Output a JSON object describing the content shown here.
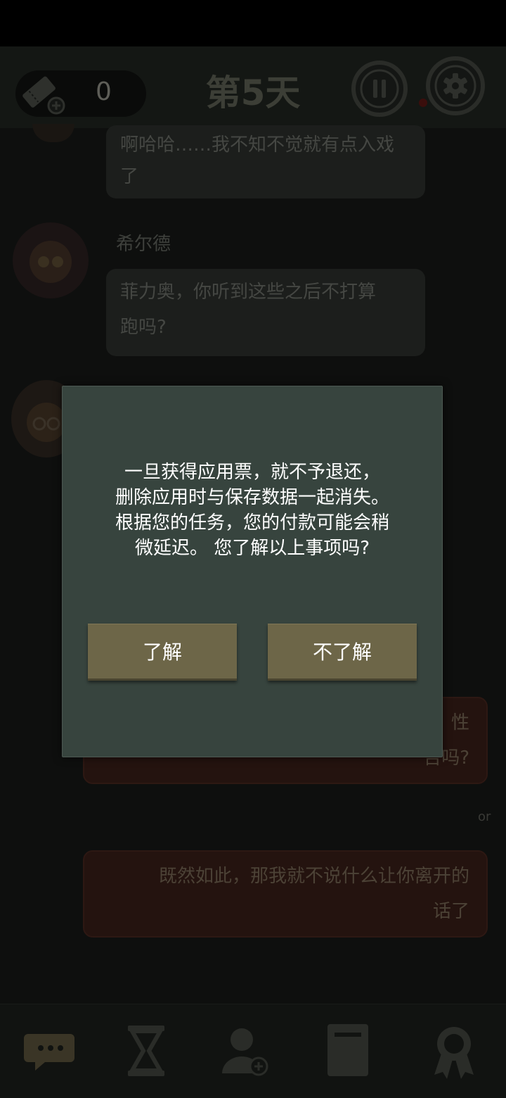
{
  "header": {
    "ticket_count": "0",
    "day_title": "第5天"
  },
  "chat": {
    "messages": [
      {
        "text_line1": "啊哈哈……我不知不觉就有点入戏",
        "text_line2": "了"
      },
      {
        "speaker": "希尔德",
        "text_line1": "菲力奥，你听到这些之后不打算",
        "text_line2": "跑吗?"
      }
    ],
    "reply_option_1": {
      "line1_fragment": "性",
      "line2_fragment": "告吗?"
    },
    "or_label": "or",
    "reply_option_2": {
      "text_line1": "既然如此，那我就不说什么让你离开的",
      "text_line2": "话了"
    }
  },
  "dialog": {
    "message_lines": [
      "一旦获得应用票，就不予退还，",
      "删除应用时与保存数据一起消失。",
      "根据您的任务，您的付款可能会稍",
      "微延迟。 您了解以上事项吗?"
    ],
    "confirm_label": "了解",
    "decline_label": "不了解"
  },
  "nav": {
    "icons": [
      "chat-icon",
      "hourglass-icon",
      "add-user-icon",
      "book-icon",
      "medal-icon"
    ]
  },
  "colors": {
    "modal_bg": "#37443e",
    "button_bg": "#6d6648",
    "overlay_bg": "#0e0f0e"
  }
}
